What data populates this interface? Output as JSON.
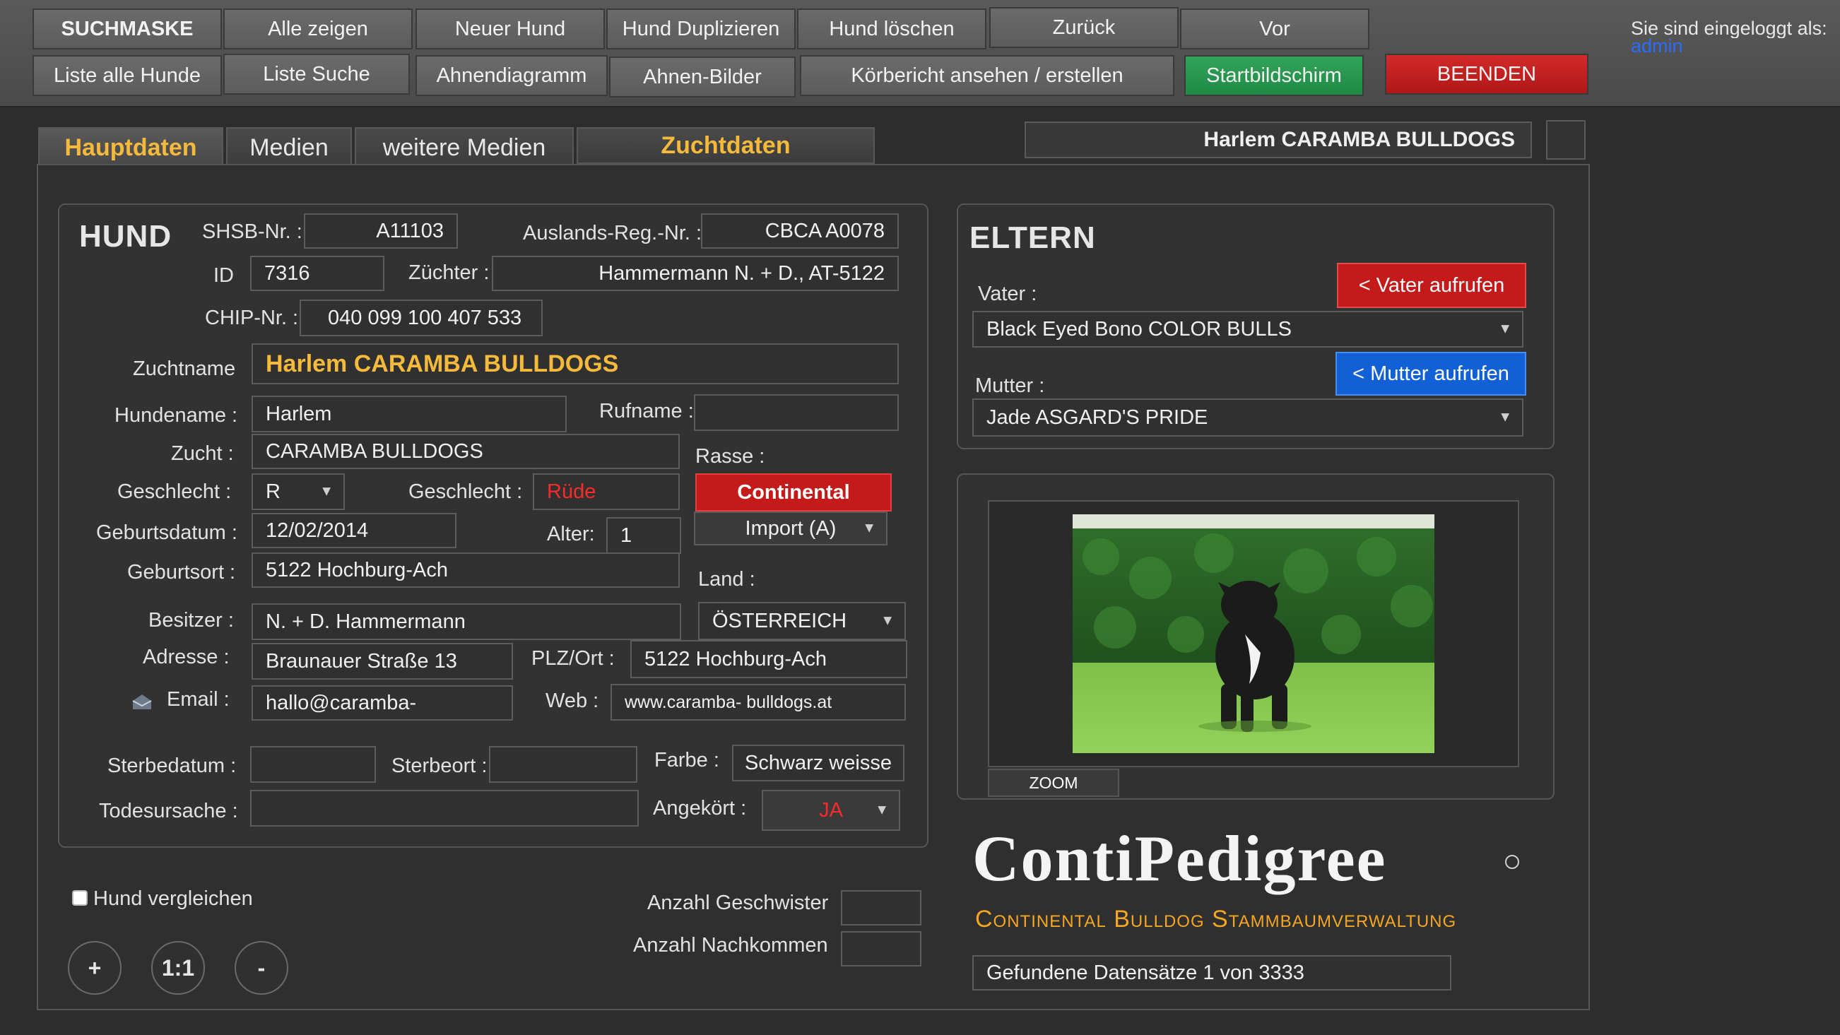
{
  "toolbar": {
    "row1": [
      "SUCHMASKE",
      "Alle zeigen",
      "Neuer Hund",
      "Hund Duplizieren",
      "Hund löschen",
      "Zurück",
      "Vor"
    ],
    "row2": [
      "Liste alle Hunde",
      "Liste Suche",
      "Ahnendiagramm",
      "Ahnen-Bilder",
      "Körbericht ansehen / erstellen",
      "Startbildschirm",
      "BEENDEN"
    ],
    "login_text": "Sie sind eingeloggt als:",
    "login_user": "admin"
  },
  "tabs": [
    "Hauptdaten",
    "Medien",
    "weitere Medien",
    "Zuchtdaten"
  ],
  "header_dog_name": "Harlem CARAMBA BULLDOGS",
  "hund": {
    "title": "HUND",
    "shsb_label": "SHSB-Nr. :",
    "shsb": "A11103",
    "auslands_label": "Auslands-Reg.-Nr. :",
    "auslands": "CBCA A0078",
    "id_label": "ID",
    "id": "7316",
    "zuechter_label": "Züchter :",
    "zuechter": "Hammermann N. + D., AT-5122",
    "chip_label": "CHIP-Nr. :",
    "chip": "040 099 100 407 533",
    "zuchtname_label": "Zuchtname",
    "zuchtname": "Harlem CARAMBA BULLDOGS",
    "hundename_label": "Hundename :",
    "hundename": "Harlem",
    "rufname_label": "Rufname :",
    "rufname": "",
    "zucht_label": "Zucht :",
    "zucht": "CARAMBA BULLDOGS",
    "rasse_label": "Rasse :",
    "rasse": "Continental",
    "geschlecht_label": "Geschlecht :",
    "geschlecht_code": "R",
    "geschlecht2_label": "Geschlecht :",
    "geschlecht": "Rüde",
    "geburtsdatum_label": "Geburtsdatum :",
    "geburtsdatum": "12/02/2014",
    "alter_label": "Alter:",
    "alter": "1",
    "import": "Import (A)",
    "geburtsort_label": "Geburtsort :",
    "geburtsort": "5122 Hochburg-Ach",
    "land_label": "Land :",
    "land": "ÖSTERREICH",
    "besitzer_label": "Besitzer :",
    "besitzer": "N. + D. Hammermann",
    "adresse_label": "Adresse :",
    "adresse": "Braunauer Straße 13",
    "plz_label": "PLZ/Ort :",
    "plz": "5122 Hochburg-Ach",
    "email_label": "Email :",
    "email": "hallo@caramba-",
    "web_label": "Web :",
    "web": "www.caramba- bulldogs.at",
    "sterbedatum_label": "Sterbedatum :",
    "sterbedatum": "",
    "sterbeort_label": "Sterbeort :",
    "sterbeort": "",
    "farbe_label": "Farbe :",
    "farbe": "Schwarz weisse",
    "todesursache_label": "Todesursache :",
    "todesursache": "",
    "angekoert_label": "Angekört :",
    "angekoert": "JA"
  },
  "eltern": {
    "title": "ELTERN",
    "vater_label": "Vater :",
    "vater": "Black Eyed Bono COLOR BULLS",
    "vater_button": "< Vater aufrufen",
    "mutter_label": "Mutter :",
    "mutter": "Jade ASGARD'S PRIDE",
    "mutter_button": "< Mutter aufrufen"
  },
  "photo": {
    "zoom_label": "ZOOM"
  },
  "logo": {
    "title": "ContiPedigree",
    "subtitle": "Continental Bulldog Stammbaumverwaltung"
  },
  "footer": {
    "compare_label": "Hund vergleichen",
    "geschwister_label": "Anzahl Geschwister",
    "geschwister": "",
    "nachkommen_label": "Anzahl Nachkommen",
    "nachkommen": "",
    "zoom_in": "+",
    "zoom_reset": "1:1",
    "zoom_out": "-",
    "records": "Gefundene Datensätze 1 von 3333"
  },
  "colors": {
    "accent_gold": "#f5b93c",
    "red": "#c41a1a",
    "blue": "#1260d6",
    "green": "#22914a"
  }
}
